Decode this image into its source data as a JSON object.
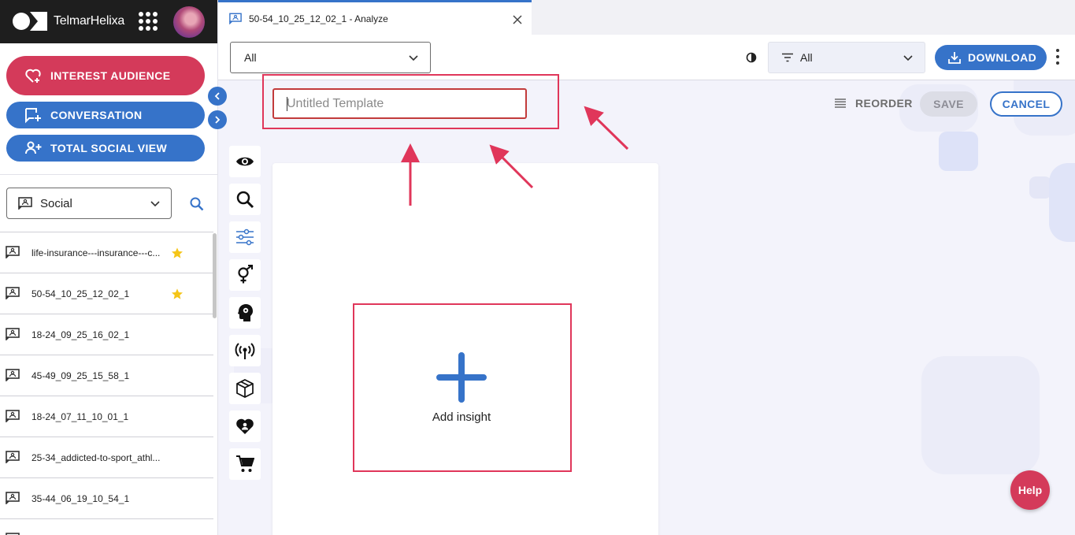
{
  "app": {
    "brand_name": "TelmarHelixa"
  },
  "sidebar": {
    "pills": [
      {
        "label": "INTEREST AUDIENCE",
        "icon": "heart-add-icon",
        "color": "#d43a5a"
      },
      {
        "label": "CONVERSATION",
        "icon": "chat-add-icon",
        "color": "#3673c9"
      },
      {
        "label": "TOTAL SOCIAL VIEW",
        "icon": "people-add-icon",
        "color": "#3673c9"
      }
    ],
    "source_select": {
      "value": "Social"
    },
    "projects": [
      {
        "label": "life-insurance---insurance---c...",
        "starred": true
      },
      {
        "label": "50-54_10_25_12_02_1",
        "starred": true
      },
      {
        "label": "18-24_09_25_16_02_1",
        "starred": false
      },
      {
        "label": "45-49_09_25_15_58_1",
        "starred": false
      },
      {
        "label": "18-24_07_11_10_01_1",
        "starred": false
      },
      {
        "label": "25-34_addicted-to-sport_athl...",
        "starred": false
      },
      {
        "label": "35-44_06_19_10_54_1",
        "starred": false
      }
    ]
  },
  "tab": {
    "title": "50-54_10_25_12_02_1 - Analyze"
  },
  "toolbar": {
    "scope_value": "All",
    "filter_value": "All",
    "download_label": "DOWNLOAD"
  },
  "editor": {
    "title_placeholder": "Untitled Template",
    "title_value": "",
    "reorder_label": "REORDER",
    "save_label": "SAVE",
    "cancel_label": "CANCEL",
    "add_insight_label": "Add insight",
    "tools": [
      "eye-icon",
      "search-icon",
      "sliders-icon",
      "gender-icon",
      "head-brain-icon",
      "broadcast-icon",
      "box-icon",
      "heart-people-icon",
      "cart-icon"
    ]
  },
  "help": {
    "label": "Help"
  },
  "colors": {
    "accent_blue": "#3673c9",
    "accent_red": "#d43a5a",
    "annotation_red": "#e0365a",
    "star_yellow": "#f5c518"
  }
}
